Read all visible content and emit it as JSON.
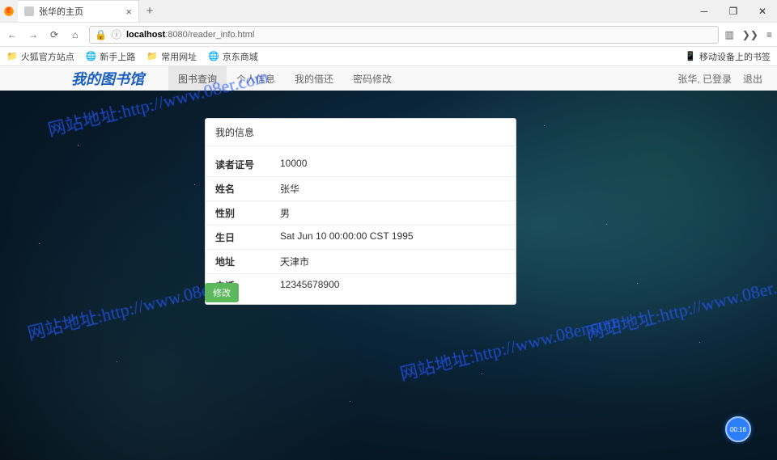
{
  "browser": {
    "tab_title": "张华的主页",
    "url_prefix": "localhost",
    "url_path": ":8080/reader_info.html",
    "bookmarks": [
      "火狐官方站点",
      "新手上路",
      "常用网址",
      "京东商城"
    ],
    "bookmark_right": "移动设备上的书签"
  },
  "nav": {
    "brand": "我的图书馆",
    "items": [
      "图书查询",
      "个人信息",
      "我的借还",
      "密码修改"
    ],
    "active_index": 0,
    "user_text": "张华, 已登录",
    "logout": "退出"
  },
  "panel": {
    "title": "我的信息",
    "rows": [
      {
        "k": "读者证号",
        "v": "10000"
      },
      {
        "k": "姓名",
        "v": "张华"
      },
      {
        "k": "性别",
        "v": "男"
      },
      {
        "k": "生日",
        "v": "Sat Jun 10 00:00:00 CST 1995"
      },
      {
        "k": "地址",
        "v": "天津市"
      },
      {
        "k": "电话",
        "v": "12345678900"
      }
    ],
    "edit": "修改"
  },
  "watermark": "网站地址:http://www.08er.com",
  "timer": "00:16"
}
